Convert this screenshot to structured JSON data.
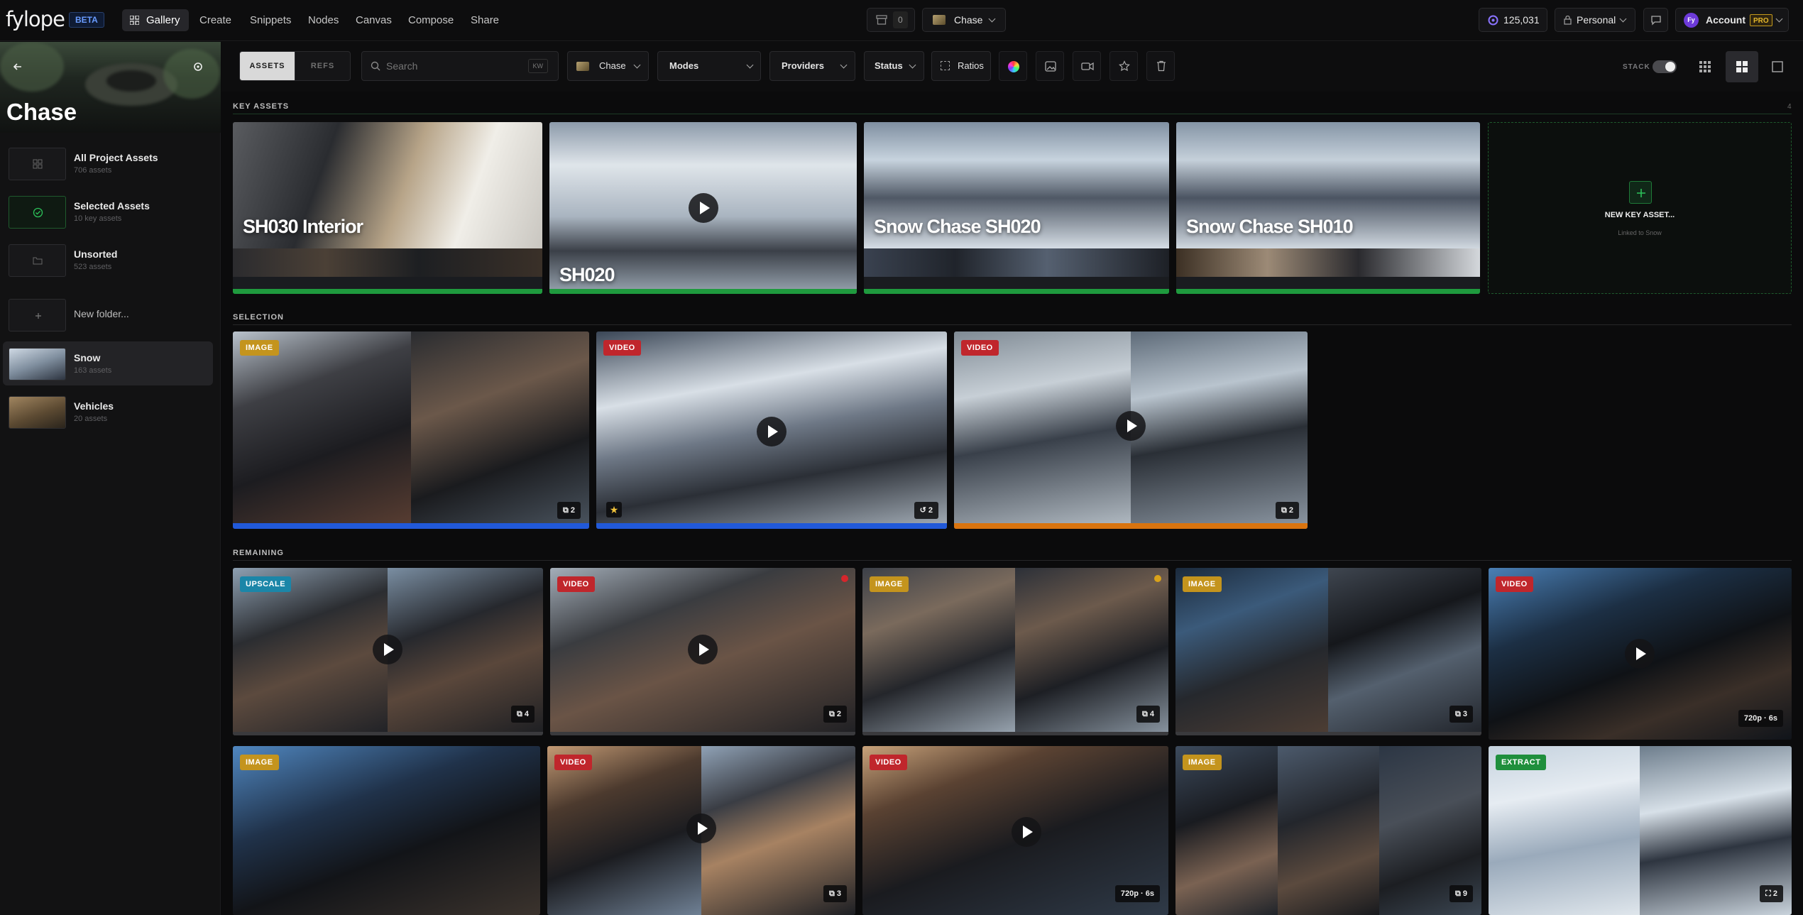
{
  "brand": {
    "logo": "fylope",
    "badge": "BETA"
  },
  "nav": [
    "Gallery",
    "Create",
    "Snippets",
    "Nodes",
    "Canvas",
    "Compose",
    "Share"
  ],
  "top": {
    "queue_count": "0",
    "project": "Chase",
    "credits": "125,031",
    "workspace": "Personal",
    "account": "Account",
    "plan": "PRO",
    "avatar_initials": "Fy"
  },
  "sidebar": {
    "title": "Chase",
    "items": [
      {
        "name": "All Project Assets",
        "sub": "706 assets"
      },
      {
        "name": "Selected Assets",
        "sub": "10 key assets"
      },
      {
        "name": "Unsorted",
        "sub": "523 assets"
      },
      {
        "name": "New folder...",
        "sub": ""
      },
      {
        "name": "Snow",
        "sub": "163 assets"
      },
      {
        "name": "Vehicles",
        "sub": "20 assets"
      }
    ]
  },
  "toolbar": {
    "tab_assets": "ASSETS",
    "tab_refs": "REFS",
    "search_placeholder": "Search",
    "search_shortcut": "KW",
    "project_filter": "Chase",
    "modes": "Modes",
    "providers": "Providers",
    "status": "Status",
    "ratios": "Ratios",
    "stack_label": "STACK"
  },
  "sections": {
    "key_assets": {
      "label": "KEY ASSETS",
      "count": "4"
    },
    "selection": {
      "label": "SELECTION"
    },
    "remaining": {
      "label": "REMAINING"
    }
  },
  "key_assets": [
    {
      "title": "SH030 Interior"
    },
    {
      "title": "SH020"
    },
    {
      "title": "Snow Chase SH020"
    },
    {
      "title": "Snow Chase SH010"
    }
  ],
  "new_key_asset": {
    "label": "NEW KEY ASSET...",
    "sub": "Linked to Snow"
  },
  "selection_cards": [
    {
      "badge": "IMAGE",
      "count": "2"
    },
    {
      "badge": "VIDEO",
      "count": "2"
    },
    {
      "badge": "VIDEO",
      "count": "2"
    }
  ],
  "remaining_cards": [
    {
      "badge": "UPSCALE",
      "count": "4"
    },
    {
      "badge": "VIDEO",
      "count": "2"
    },
    {
      "badge": "IMAGE",
      "count": "4"
    },
    {
      "badge": "IMAGE",
      "count": "3"
    },
    {
      "badge": "VIDEO",
      "meta": "720p · 6s"
    },
    {
      "badge": "IMAGE"
    },
    {
      "badge": "VIDEO",
      "count": "3"
    },
    {
      "badge": "VIDEO",
      "meta": "720p · 6s"
    },
    {
      "badge": "IMAGE",
      "count": "9"
    },
    {
      "badge": "EXTRACT",
      "count": "2"
    }
  ],
  "colors": {
    "accent_green": "#1f9a3e",
    "accent_blue": "#2159d9",
    "accent_orange": "#d9740f",
    "video_red": "#c0262c",
    "image_gold": "#c4941d"
  }
}
